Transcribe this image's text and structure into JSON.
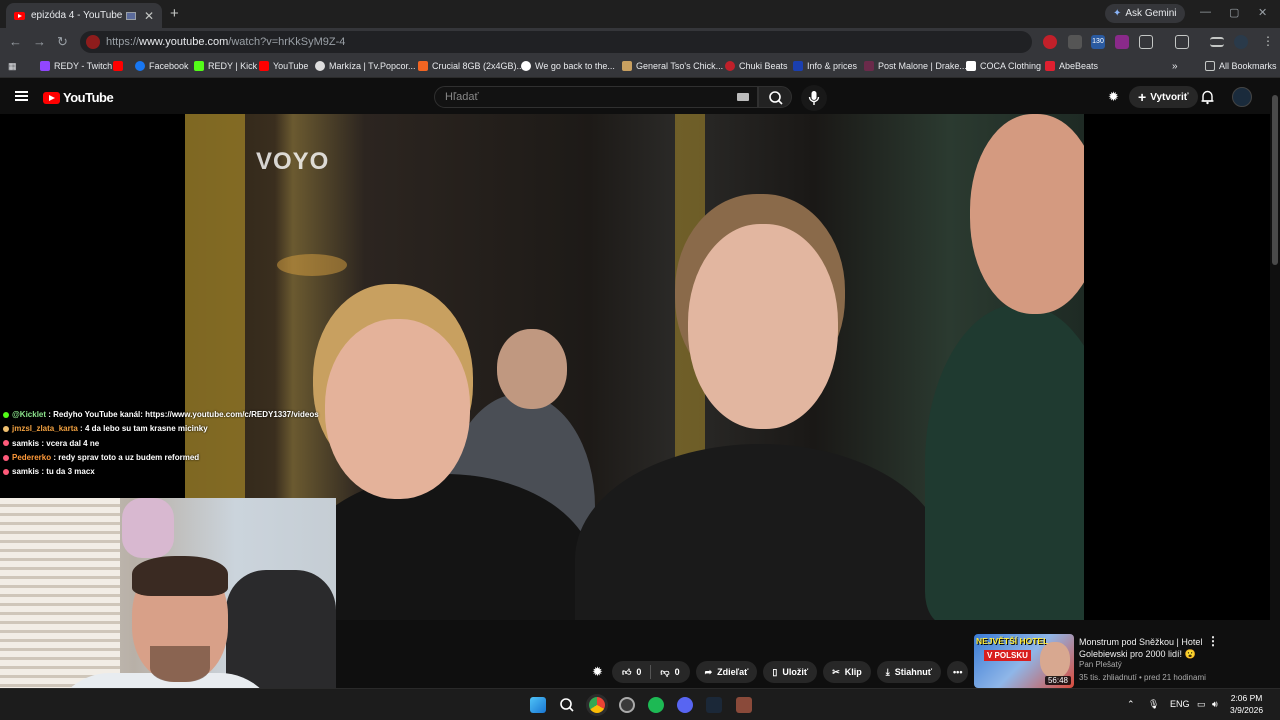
{
  "browser": {
    "tab_title": "epizóda 4 - YouTube",
    "new_tab": "+",
    "tab_close": "✕",
    "ask_gemini": "Ask Gemini",
    "url_prefix": "https://",
    "url_host": "www.youtube.com",
    "url_path": "/watch?v=hrKkSyM9Z-4",
    "extension_badge": "130",
    "bookmarks": [
      {
        "label": "REDY - Twitch",
        "color": "#9146ff"
      },
      {
        "label": "",
        "color": "#ff0000"
      },
      {
        "label": "Facebook",
        "color": "#1877f2"
      },
      {
        "label": "REDY | Kick",
        "color": "#53fc18"
      },
      {
        "label": "YouTube",
        "color": "#ff0000"
      },
      {
        "label": "Markíza | Tv.Popcor...",
        "color": "#dddddd"
      },
      {
        "label": "Crucial 8GB (2x4GB)...",
        "color": "#f26522"
      },
      {
        "label": "We go back to the...",
        "color": "#ffffff"
      },
      {
        "label": "General Tso's Chick...",
        "color": "#c8a060"
      },
      {
        "label": "Chuki Beats",
        "color": "#c0202a"
      },
      {
        "label": "Info & prices",
        "color": "#1a3fb0"
      },
      {
        "label": "Post Malone | Drake...",
        "color": "#6a2a4a"
      },
      {
        "label": "COCA Clothing",
        "color": "#ffffff"
      },
      {
        "label": "AbeBeats",
        "color": "#e02030"
      }
    ],
    "all_bookmarks": "All Bookmarks"
  },
  "youtube": {
    "logo_text": "YouTube",
    "search_placeholder": "Hľadať",
    "create_label": "Vytvoriť",
    "watermark": "VOYO",
    "actions": {
      "like_count": "0",
      "dislike_count": "0",
      "share": "Zdieľať",
      "save": "Uložiť",
      "clip": "Klip",
      "download": "Stiahnuť"
    },
    "recommendation": {
      "thumb_line1": "NEJVĚTŠÍ HOTEL",
      "thumb_line2": "V POLSKU",
      "duration": "56:48",
      "title": "Monstrum pod Sněžkou | Hotel Golebiewski pro 2000 lidí! 😮",
      "channel": "Pan Plešatý",
      "meta": "35 tis. zhliadnutí • pred 21 hodinami"
    }
  },
  "chat": [
    {
      "user": "@Kicklet",
      "color": "#8be28b",
      "dot": "#53fc18",
      "text": "Redyho YouTube kanál: https://www.youtube.com/c/REDY1337/videos"
    },
    {
      "user": "jmzsl_zlata_karta",
      "color": "#f0a040",
      "dot": "#f0c070",
      "text": "4 da lebo su tam krasne micinky"
    },
    {
      "user": "samkis",
      "color": "#ffffff",
      "dot": "#ff5a7a",
      "text": "vcera dal 4 ne"
    },
    {
      "user": "Pedererko",
      "color": "#ff9a3a",
      "dot": "#ff5a7a",
      "text": "redy sprav toto a uz budem reformed"
    },
    {
      "user": "samkis",
      "color": "#ffffff",
      "dot": "#ff5a7a",
      "text": "tu da 3 macx"
    }
  ],
  "taskbar": {
    "lang": "ENG",
    "time": "2:06 PM",
    "date": "3/9/2026"
  }
}
